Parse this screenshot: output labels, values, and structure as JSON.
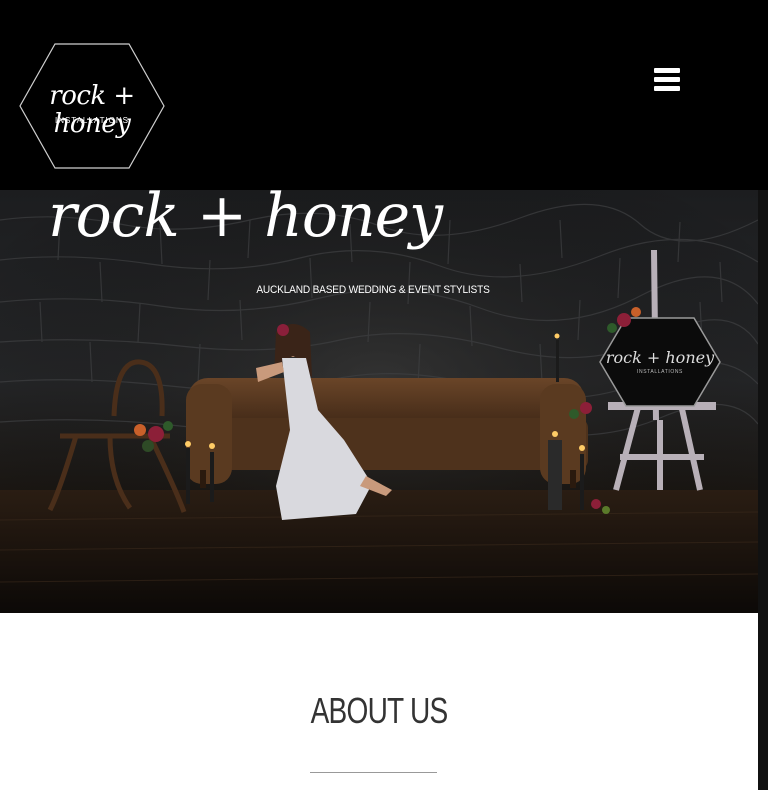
{
  "header": {
    "logo": {
      "script_text": "rock + honey",
      "sub_text": "INSTALLATIONS"
    },
    "menu_icon": "hamburger-menu-icon"
  },
  "hero": {
    "title": "rock + honey",
    "tagline": "AUCKLAND BASED WEDDING & EVENT STYLISTS",
    "sign": {
      "script_text": "rock + honey",
      "sub_text": "INSTALLATIONS"
    }
  },
  "about": {
    "heading": "ABOUT US"
  },
  "colors": {
    "header_bg": "#000000",
    "page_bg": "#ffffff",
    "heading_text": "#333333"
  }
}
